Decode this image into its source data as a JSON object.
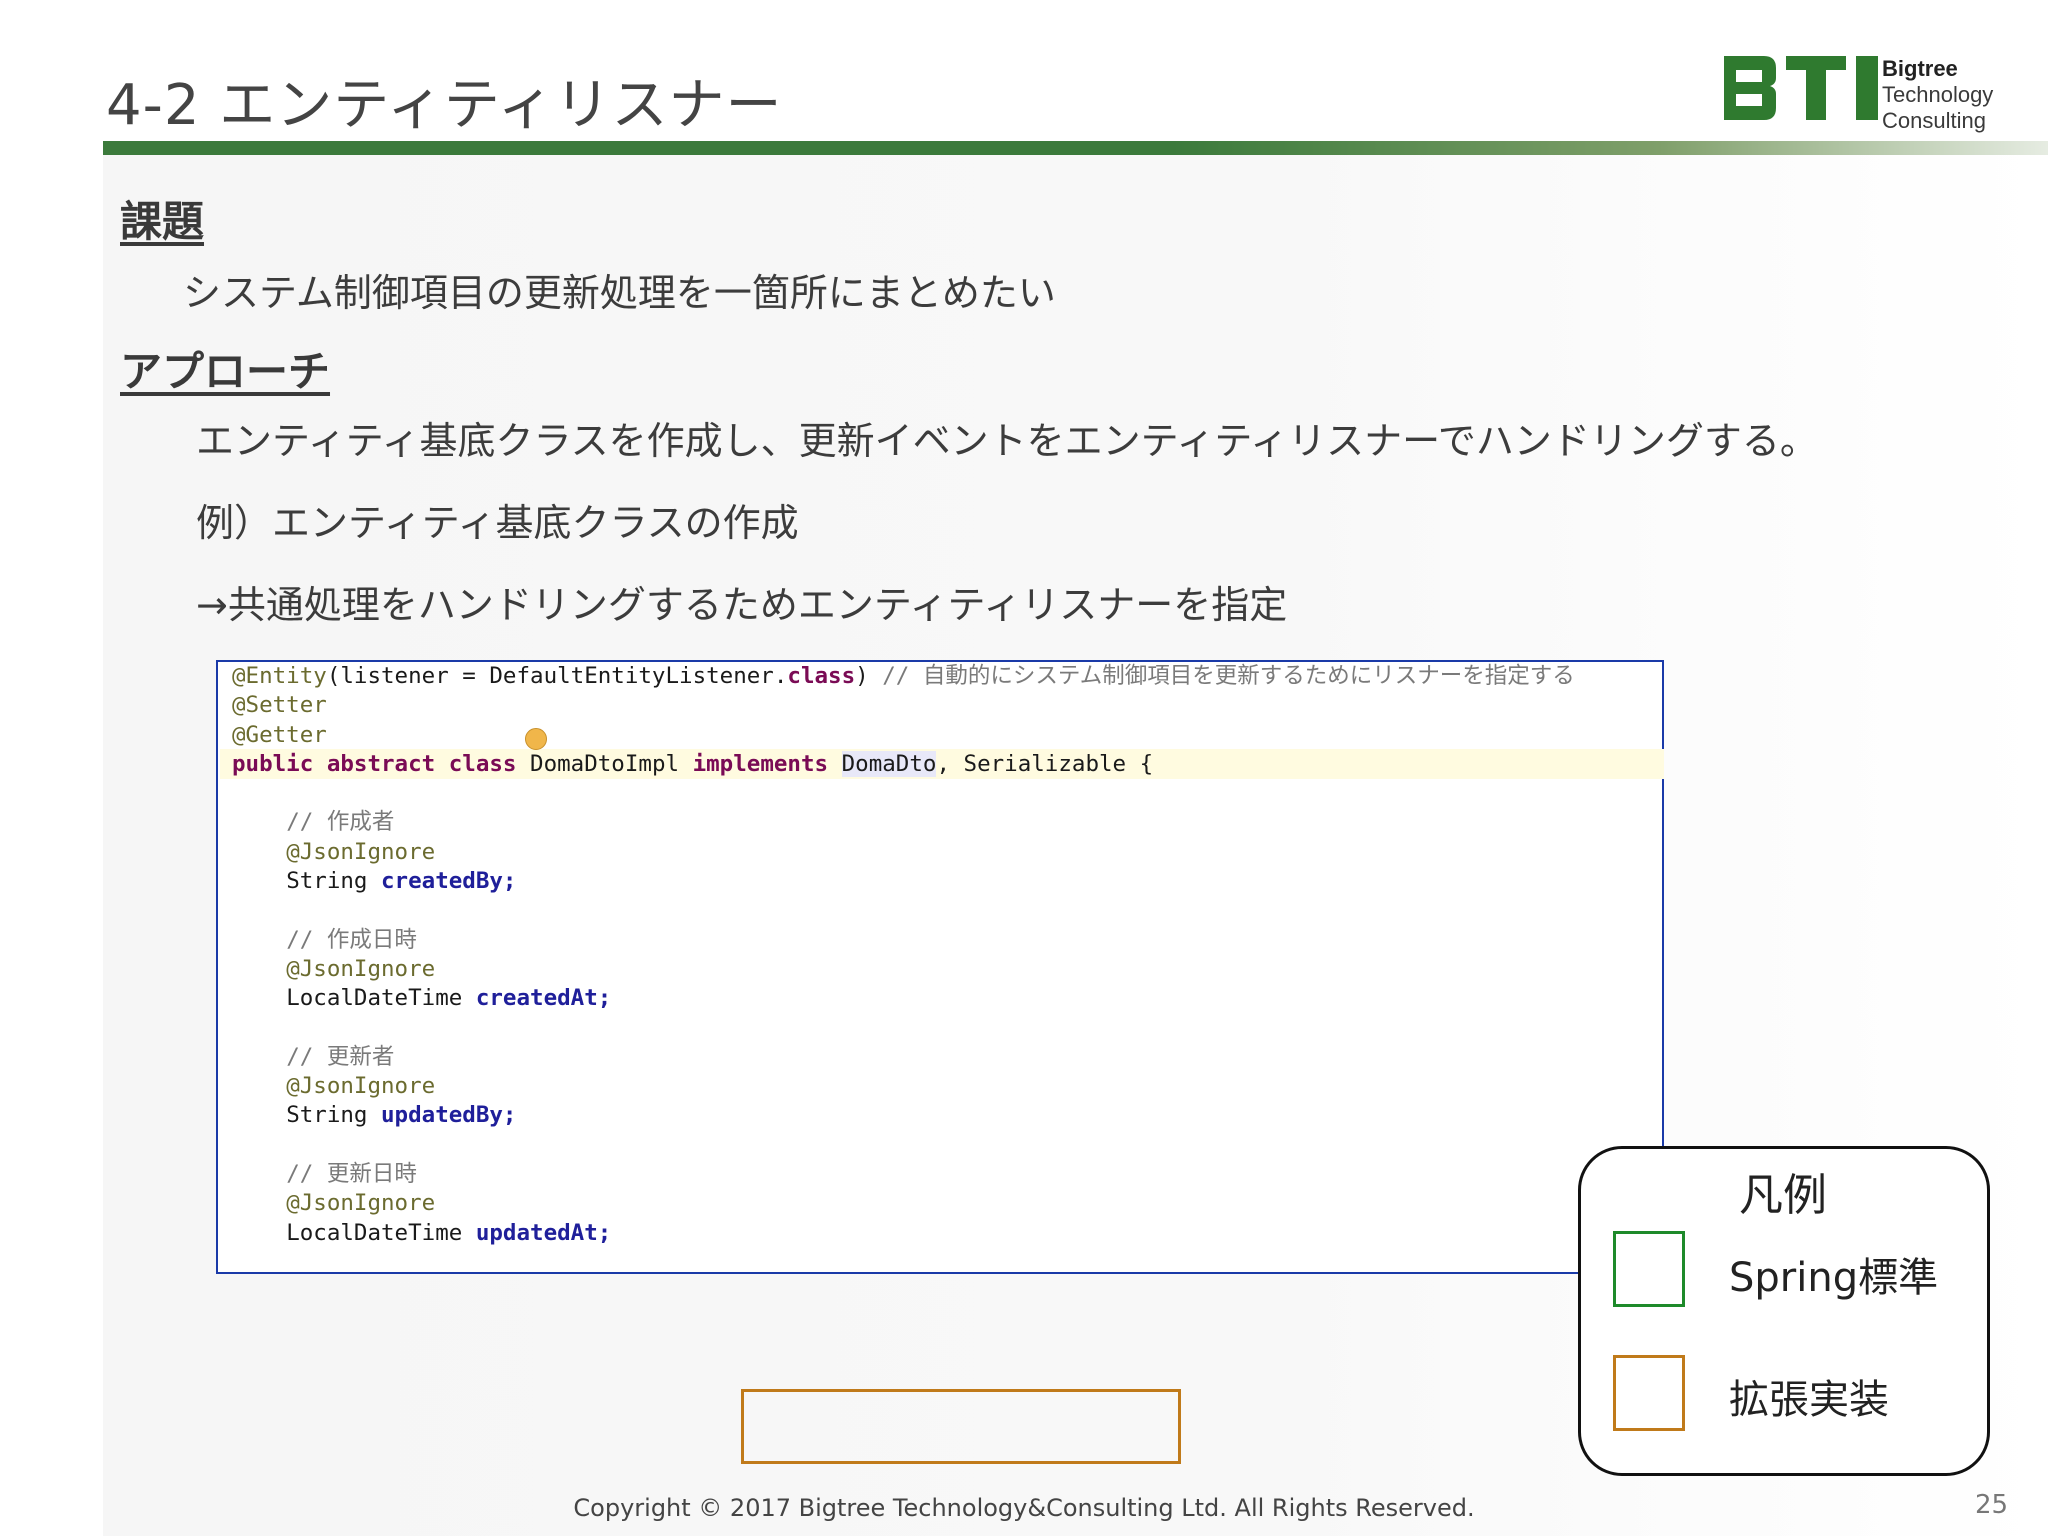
{
  "slide": {
    "title": "4-2 エンティティリスナー",
    "logo": {
      "line1": "Bigtree",
      "line2": "Technology",
      "line3": "Consulting",
      "colors": {
        "green": "#2e7d32"
      }
    },
    "task_heading": "課題",
    "task_text": "システム制御項目の更新処理を一箇所にまとめたい",
    "approach_heading": "アプローチ",
    "approach_lines": [
      "エンティティ基底クラスを作成し、更新イベントをエンティティリスナーでハンドリングする。",
      "例）エンティティ基底クラスの作成",
      "→共通処理をハンドリングするためエンティティリスナーを指定"
    ],
    "code": {
      "line1_annotation": "@Entity",
      "line1_args": "(listener = DefaultEntityListener.",
      "line1_kw": "class",
      "line1_close": ")",
      "line1_comment": " // 自動的にシステム制御項目を更新するためにリスナーを指定する",
      "line2": "@Setter",
      "line3": "@Getter",
      "line4_kw": "public abstract class",
      "line4_class": "DomaDtoImpl",
      "line4_impl": "implements",
      "line4_iface": "DomaDto",
      "line4_rest": ", Serializable {",
      "fields": [
        {
          "comment": "// 作成者",
          "annotation": "@JsonIgnore",
          "type": "String",
          "name": "createdBy;"
        },
        {
          "comment": "// 作成日時",
          "annotation": "@JsonIgnore",
          "type": "LocalDateTime",
          "name": "createdAt;"
        },
        {
          "comment": "// 更新者",
          "annotation": "@JsonIgnore",
          "type": "String",
          "name": "updatedBy;"
        },
        {
          "comment": "// 更新日時",
          "annotation": "@JsonIgnore",
          "type": "LocalDateTime",
          "name": "updatedAt;"
        }
      ]
    },
    "legend": {
      "title": "凡例",
      "items": [
        {
          "label": "Spring標準",
          "color": "#1e8a2a"
        },
        {
          "label": "拡張実装",
          "color": "#c07a1a"
        }
      ]
    },
    "footer": {
      "copyright": "Copyright © 2017 Bigtree Technology&Consulting Ltd. All Rights Reserved.",
      "page_number": "25"
    }
  }
}
